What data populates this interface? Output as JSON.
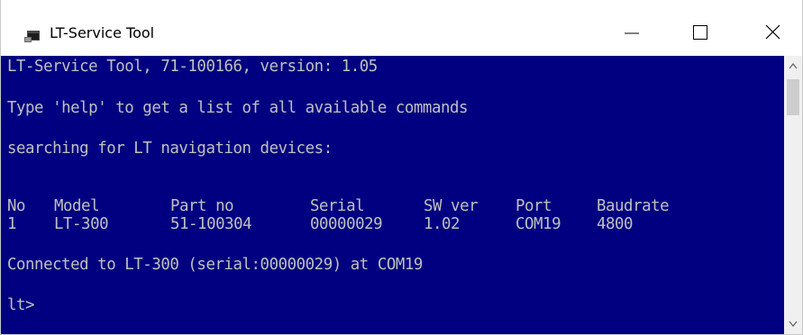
{
  "window": {
    "title": "LT-Service Tool",
    "icon": "console-app-icon",
    "controls": {
      "minimize": "minimize-icon",
      "maximize": "maximize-icon",
      "close": "close-icon"
    }
  },
  "console": {
    "background": "#000080",
    "foreground": "#c0c0c0",
    "banner": "LT-Service Tool, 71-100166, version: 1.05",
    "help_hint": "Type 'help' to get a list of all available commands",
    "searching": "searching for LT navigation devices:",
    "table": {
      "headers": [
        "No",
        "Model",
        "Part no",
        "Serial",
        "SW ver",
        "Port",
        "Baudrate"
      ],
      "rows": [
        [
          "1",
          "LT-300",
          "51-100304",
          "00000029",
          "1.02",
          "COM19",
          "4800"
        ]
      ]
    },
    "connected": "Connected to LT-300 (serial:00000029) at COM19",
    "prompt": "lt>"
  },
  "scrollbar": {
    "up": "scroll-up-arrow-icon",
    "down": "scroll-down-arrow-icon"
  }
}
